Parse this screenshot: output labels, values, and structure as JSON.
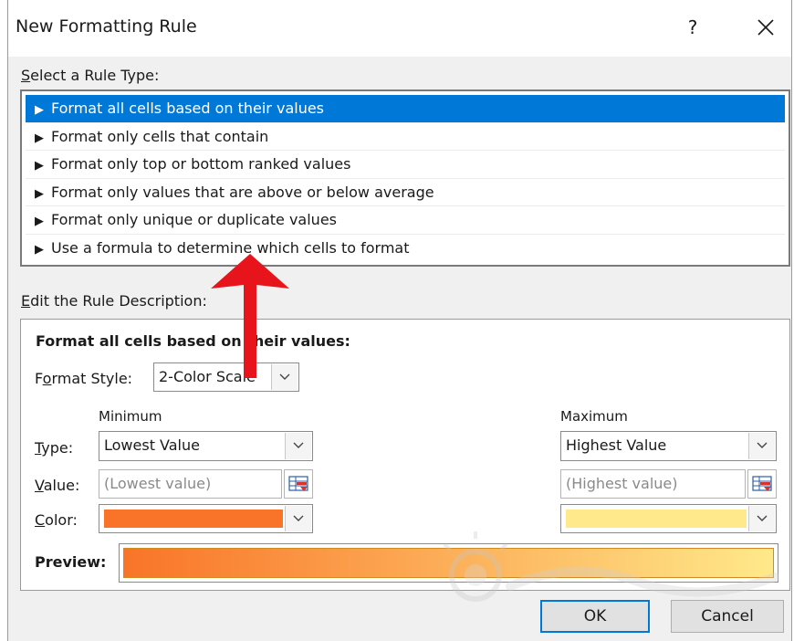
{
  "window": {
    "title": "New Formatting Rule",
    "help_label": "?"
  },
  "rule_type": {
    "label_accel": "S",
    "label_rest": "elect a Rule Type:",
    "items": [
      {
        "label": "Format all cells based on their values",
        "selected": true
      },
      {
        "label": "Format only cells that contain",
        "selected": false
      },
      {
        "label": "Format only top or bottom ranked values",
        "selected": false
      },
      {
        "label": "Format only values that are above or below average",
        "selected": false
      },
      {
        "label": "Format only unique or duplicate values",
        "selected": false
      },
      {
        "label": "Use a formula to determine which cells to format",
        "selected": false
      }
    ]
  },
  "description": {
    "label_accel": "E",
    "label_rest": "dit the Rule Description:",
    "heading": "Format all cells based on their values:",
    "format_style_label_accel": "o",
    "format_style_label_pre": "F",
    "format_style_label_post": "rmat Style:",
    "format_style_value": "2-Color Scale",
    "minimum": {
      "header": "Minimum",
      "type_value": "Lowest Value",
      "value_placeholder": "(Lowest value)",
      "color": "#f97428"
    },
    "maximum": {
      "header": "Maximum",
      "type_value": "Highest Value",
      "value_placeholder": "(Highest value)",
      "color": "#ffe98a"
    },
    "row_labels": {
      "type_accel": "T",
      "type_rest": "ype:",
      "value_accel": "V",
      "value_rest": "alue:",
      "color_accel": "C",
      "color_rest": "olor:"
    },
    "preview_label": "Preview:"
  },
  "buttons": {
    "ok": "OK",
    "cancel": "Cancel"
  },
  "colors": {
    "selection": "#0078d7",
    "annotation_arrow": "#e8141c"
  },
  "icons": {
    "close": "close-icon",
    "dropdown": "chevron-down-icon",
    "range_picker": "range-picker-icon",
    "rule_arrow": "triangle-right-icon"
  }
}
